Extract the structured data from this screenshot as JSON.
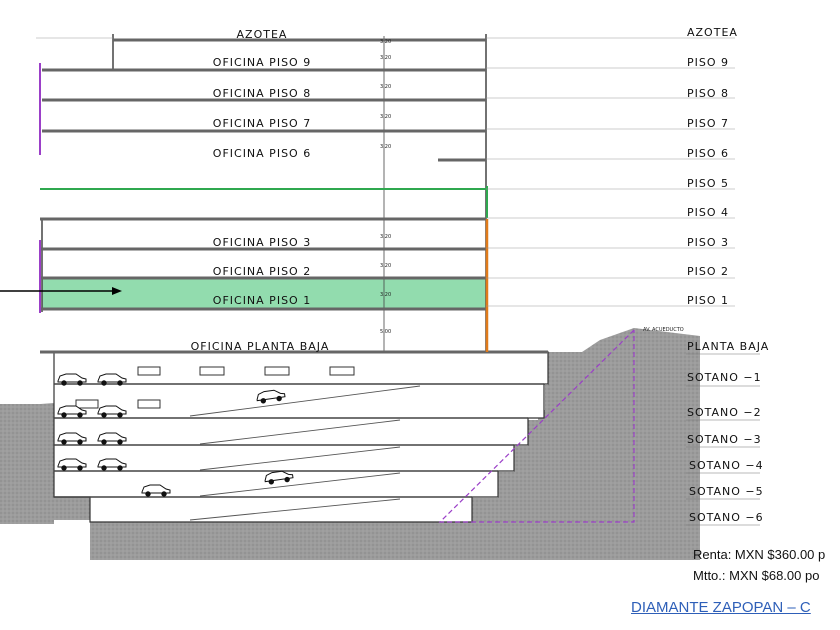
{
  "floors_left": [
    {
      "id": "azotea",
      "label": "AZOTEA",
      "dim": "3.20"
    },
    {
      "id": "of9",
      "label": "OFICINA  PISO  9",
      "dim": "3.20"
    },
    {
      "id": "of8",
      "label": "OFICINA  PISO  8",
      "dim": "3.20"
    },
    {
      "id": "of7",
      "label": "OFICINA  PISO  7",
      "dim": "3.20"
    },
    {
      "id": "of6",
      "label": "OFICINA  PISO  6",
      "dim": "3.20"
    },
    {
      "id": "of3",
      "label": "OFICINA  PISO  3",
      "dim": "3.20"
    },
    {
      "id": "of2",
      "label": "OFICINA  PISO  2",
      "dim": "3.20"
    },
    {
      "id": "of1",
      "label": "OFICINA  PISO  1",
      "dim": "3.20"
    },
    {
      "id": "pb",
      "label": "OFICINA  PLANTA  BAJA",
      "dim": "5.00"
    }
  ],
  "levels_right": [
    "AZOTEA",
    "PISO  9",
    "PISO  8",
    "PISO  7",
    "PISO  6",
    "PISO  5",
    "PISO  4",
    "PISO  3",
    "PISO  2",
    "PISO  1",
    "PLANTA  BAJA",
    "SOTANO  −1",
    "SOTANO  −2",
    "SOTANO  −3",
    "SOTANO  −4",
    "SOTANO  −5",
    "SOTANO  −6"
  ],
  "street_label": "AV. ACUEDUCTO",
  "highlighted_floor": "OFICINA  PISO  1",
  "rent_text": "Renta: MXN $360.00 p",
  "mtto_text": "Mtto.: MXN $68.00 po",
  "title_link": "DIAMANTE ZAPOPAN – C",
  "colors": {
    "highlight": "#7fd6a0",
    "terrain": "#9a9a9a",
    "accent_green": "#2fa84f",
    "accent_orange": "#e07b1a",
    "dash_purple": "#9b3fc8",
    "link": "#2e5fb8"
  }
}
